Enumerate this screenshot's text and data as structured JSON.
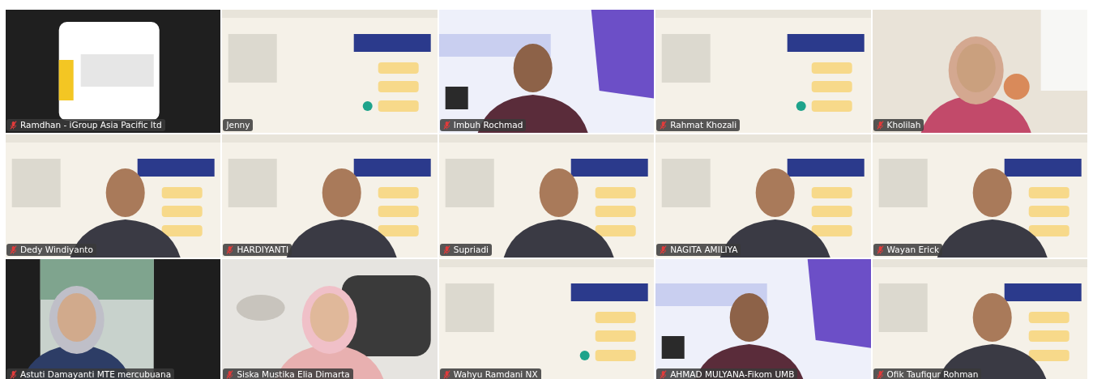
{
  "tiles": [
    {
      "name": "Ramdhan - iGroup Asia Pacific ltd",
      "muted": true,
      "kind": "picture"
    },
    {
      "name": "Jenny",
      "muted": false,
      "kind": "picture"
    },
    {
      "name": "Imbuh Rochmad",
      "muted": true,
      "kind": "picture"
    },
    {
      "name": "Rahmat Khozali",
      "muted": true,
      "kind": "picture"
    },
    {
      "name": "Kholilah",
      "muted": true,
      "kind": "picture"
    },
    {
      "name": "Dedy Windiyanto",
      "muted": true,
      "kind": "picture"
    },
    {
      "name": "HARDIYANTI",
      "muted": true,
      "kind": "picture"
    },
    {
      "name": "Supriadi",
      "muted": true,
      "kind": "picture"
    },
    {
      "name": "NAGITA AMILIYA",
      "muted": true,
      "kind": "picture"
    },
    {
      "name": "Wayan Erick",
      "muted": true,
      "kind": "picture"
    },
    {
      "name": "Astuti Damayanti MTE mercubuana",
      "muted": true,
      "kind": "picture"
    },
    {
      "name": "Siska Mustika Elia Dimarta",
      "muted": true,
      "kind": "picture"
    },
    {
      "name": "Wahyu Ramdani NX",
      "muted": true,
      "kind": "picture"
    },
    {
      "name": "AHMAD MULYANA-Fikom UMB",
      "muted": true,
      "kind": "picture"
    },
    {
      "name": "Ofik Taufiqur Rohman",
      "muted": true,
      "kind": "picture"
    }
  ]
}
